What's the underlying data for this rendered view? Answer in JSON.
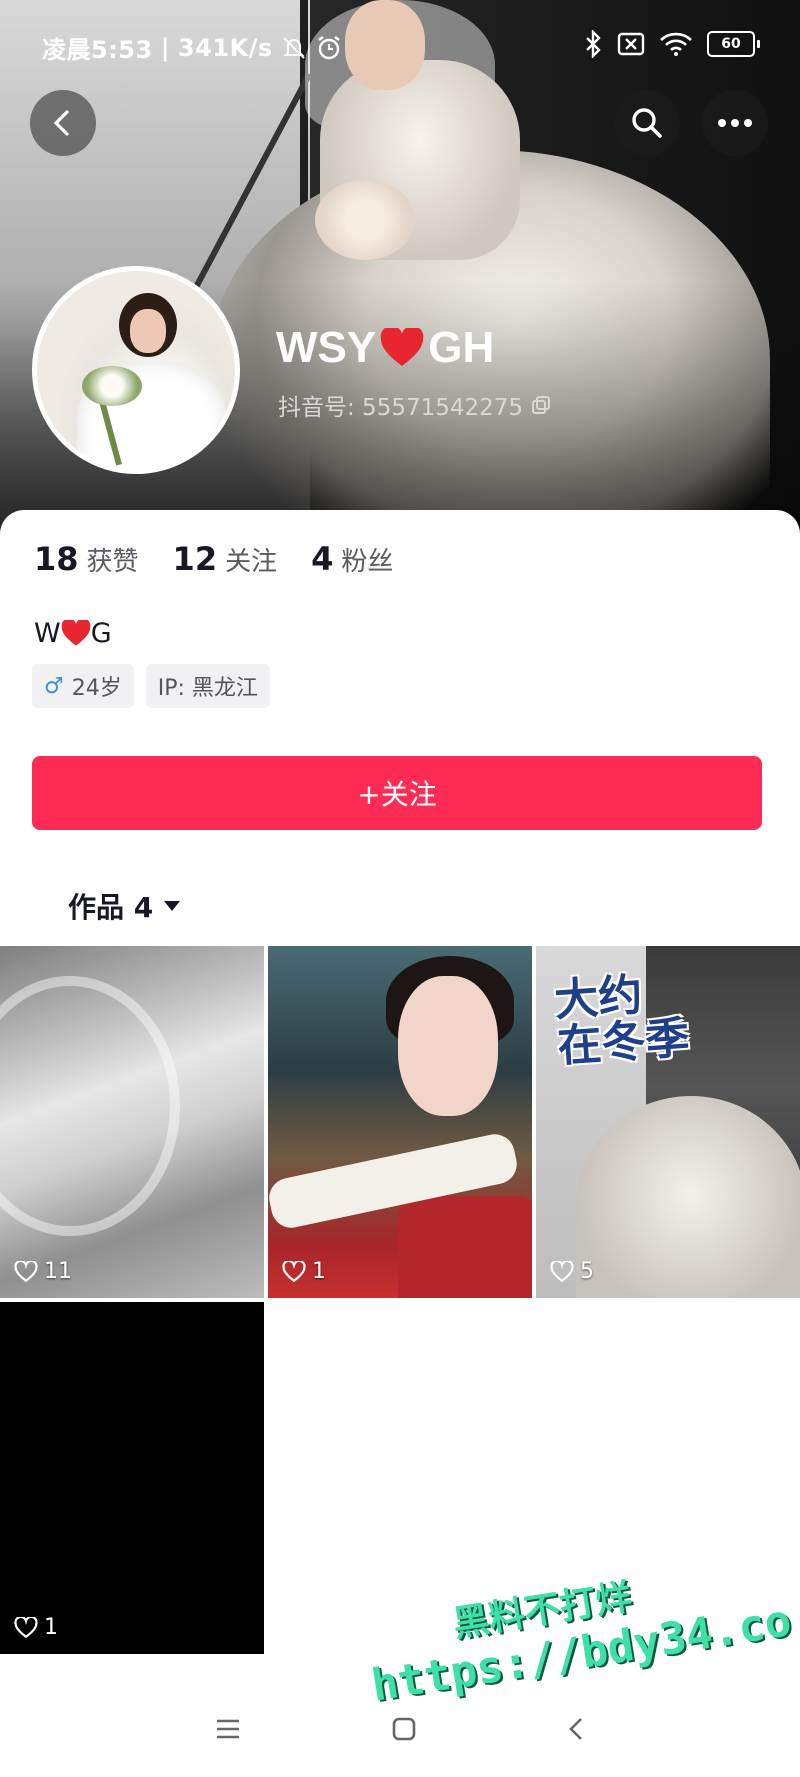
{
  "status_bar": {
    "time": "凌晨5:53",
    "separator": "|",
    "net_speed": "341K/s",
    "battery": "60"
  },
  "profile": {
    "name_part1": "WSY",
    "name_part2": "GH",
    "douyin_id": "抖音号: 55571542275",
    "bio_part1": "W",
    "bio_part2": "G"
  },
  "stats": [
    {
      "value": "18",
      "label": "获赞"
    },
    {
      "value": "12",
      "label": "关注"
    },
    {
      "value": "4",
      "label": "粉丝"
    }
  ],
  "tags": {
    "gender_symbol": "♂",
    "age": "24岁",
    "ip": "IP: 黑龙江"
  },
  "follow_button": "+关注",
  "works_tab": {
    "label": "作品 4"
  },
  "videos": [
    {
      "likes": "11"
    },
    {
      "likes": "1"
    },
    {
      "likes": "5",
      "overlay_title_line1": "大约",
      "overlay_title_line2": "在冬季"
    },
    {
      "likes": "1"
    }
  ],
  "watermark": {
    "line1": "黑料不打烊",
    "line2": "https://bdy34.co"
  },
  "colors": {
    "accent": "#fe2c55",
    "heart": "#e8262f"
  }
}
